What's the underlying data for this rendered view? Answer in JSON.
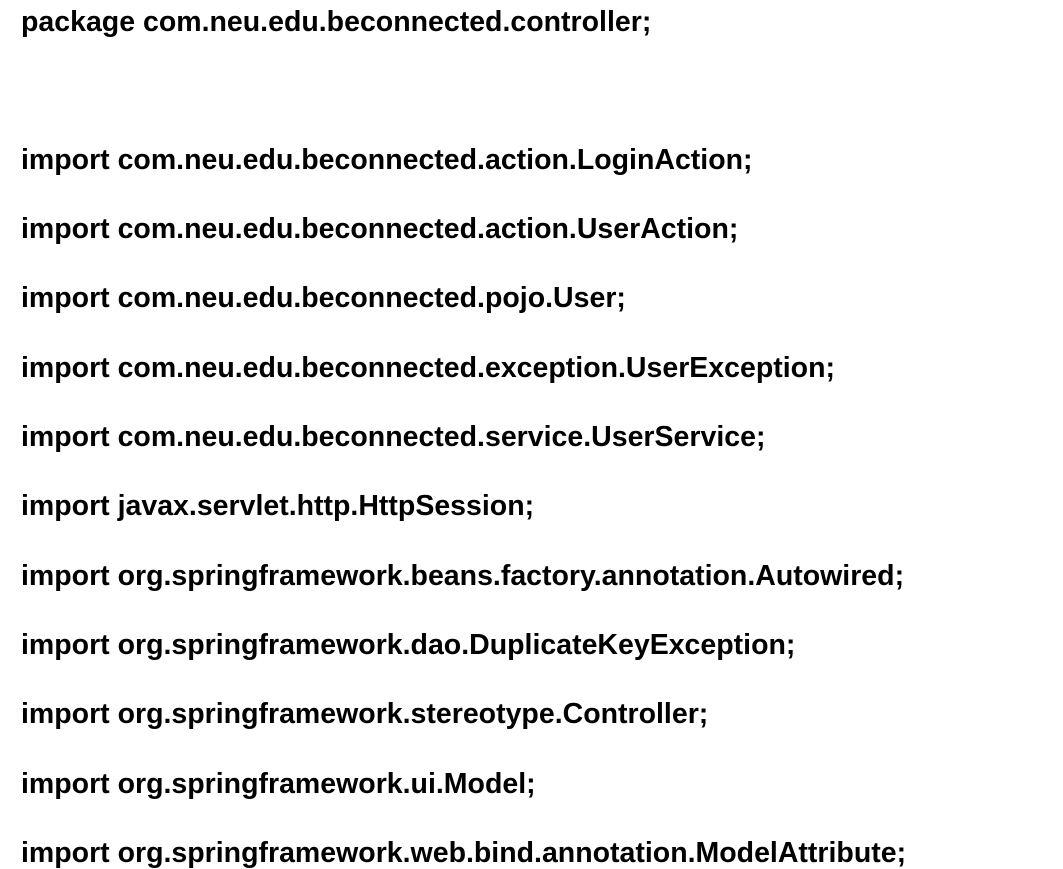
{
  "document": {
    "package_line": "package com.neu.edu.beconnected.controller;",
    "imports": [
      "import com.neu.edu.beconnected.action.LoginAction;",
      "import com.neu.edu.beconnected.action.UserAction;",
      "import com.neu.edu.beconnected.pojo.User;",
      "import com.neu.edu.beconnected.exception.UserException;",
      "import com.neu.edu.beconnected.service.UserService;",
      "import javax.servlet.http.HttpSession;",
      "import org.springframework.beans.factory.annotation.Autowired;",
      "import org.springframework.dao.DuplicateKeyException;",
      "import org.springframework.stereotype.Controller;",
      "import org.springframework.ui.Model;",
      "import org.springframework.web.bind.annotation.ModelAttribute;"
    ]
  },
  "colors": {
    "background": "#ffffff",
    "text": "#000000"
  }
}
